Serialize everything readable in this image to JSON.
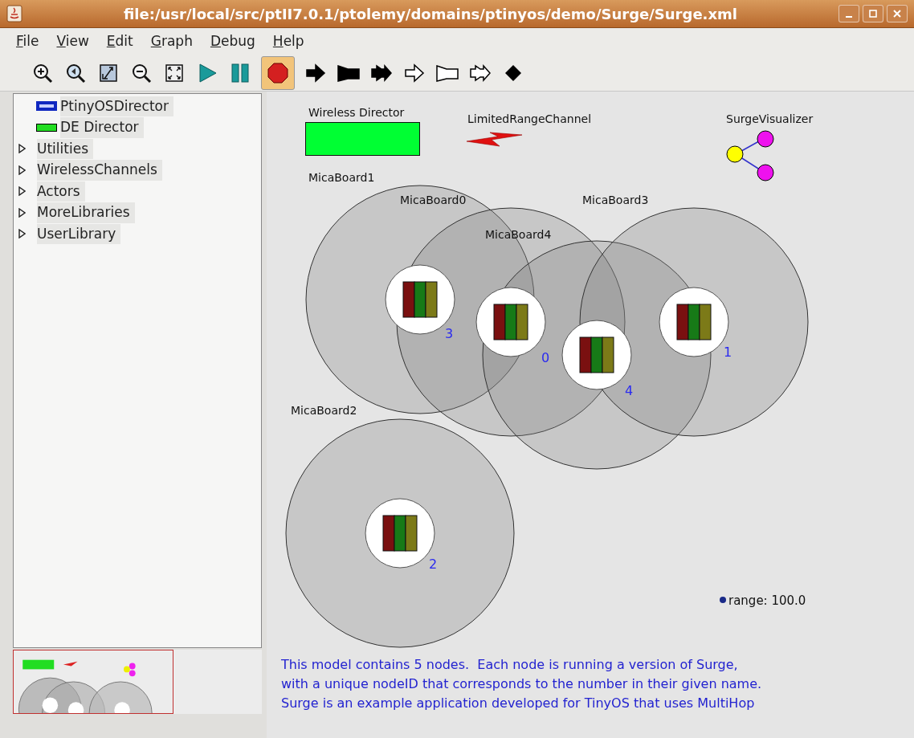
{
  "window": {
    "title": "file:/usr/local/src/ptII7.0.1/ptolemy/domains/ptinyos/demo/Surge/Surge.xml"
  },
  "menu": [
    {
      "label": "File"
    },
    {
      "label": "View"
    },
    {
      "label": "Edit"
    },
    {
      "label": "Graph"
    },
    {
      "label": "Debug"
    },
    {
      "label": "Help"
    }
  ],
  "toolbar": [
    {
      "kind": "zoom-in",
      "pressed": false
    },
    {
      "kind": "zoom-reset",
      "pressed": false
    },
    {
      "kind": "zoom-fit",
      "pressed": false
    },
    {
      "kind": "zoom-out",
      "pressed": false
    },
    {
      "kind": "full-screen",
      "pressed": false
    },
    {
      "kind": "run",
      "pressed": false
    },
    {
      "kind": "pause",
      "pressed": false
    },
    {
      "kind": "stop",
      "pressed": true
    },
    {
      "kind": "arrow",
      "pressed": false
    },
    {
      "kind": "flag",
      "pressed": false
    },
    {
      "kind": "double",
      "pressed": false
    },
    {
      "kind": "arrow-outline",
      "pressed": false
    },
    {
      "kind": "flag-outline",
      "pressed": false
    },
    {
      "kind": "double-outline",
      "pressed": false
    },
    {
      "kind": "diamond",
      "pressed": false
    }
  ],
  "library": [
    {
      "label": "PtinyOSDirector",
      "kind": "tinyos-director"
    },
    {
      "label": "DE Director",
      "kind": "de-director"
    },
    {
      "label": "Utilities",
      "kind": "library",
      "expanded": false
    },
    {
      "label": "WirelessChannels",
      "kind": "library",
      "expanded": false
    },
    {
      "label": "Actors",
      "kind": "library",
      "expanded": false
    },
    {
      "label": "MoreLibraries",
      "kind": "library",
      "expanded": false
    },
    {
      "label": "UserLibrary",
      "kind": "library",
      "expanded": false
    }
  ],
  "canvas": {
    "director": {
      "label": "Wireless Director"
    },
    "channel": {
      "label": "LimitedRangeChannel"
    },
    "visualizer": {
      "label": "SurgeVisualizer"
    },
    "boards": [
      {
        "name": "MicaBoard1",
        "node_id": "3"
      },
      {
        "name": "MicaBoard0",
        "node_id": "0"
      },
      {
        "name": "MicaBoard4",
        "node_id": "4"
      },
      {
        "name": "MicaBoard3",
        "node_id": "1"
      },
      {
        "name": "MicaBoard2",
        "node_id": "2"
      }
    ],
    "range": "range: 100.0",
    "description": "This model contains 5 nodes.  Each node is running a version of Surge,\nwith a unique nodeID that corresponds to the number in their given name.\nSurge is an example application developed for TinyOS that uses MultiHop"
  }
}
